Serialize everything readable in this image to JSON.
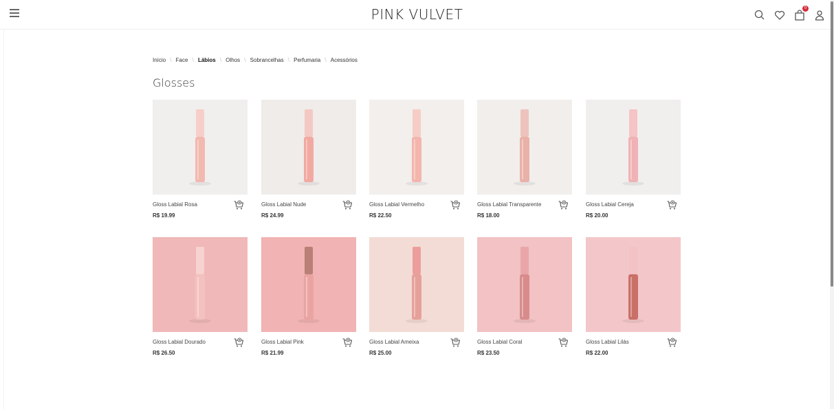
{
  "header": {
    "brand": "PINK VULVET",
    "cart_count": "0"
  },
  "breadcrumb": [
    {
      "label": "Início",
      "active": false
    },
    {
      "label": "Face",
      "active": false
    },
    {
      "label": "Lábios",
      "active": true
    },
    {
      "label": "Olhos",
      "active": false
    },
    {
      "label": "Sobrancelhas",
      "active": false
    },
    {
      "label": "Perfumaria",
      "active": false
    },
    {
      "label": "Acessórios",
      "active": false
    }
  ],
  "page_title": "Glosses",
  "products": [
    {
      "name": "Gloss Labial Rosa",
      "price": "R$ 19.99",
      "bg": "#f1efed",
      "tube": "#f2b9b0",
      "cap": "#f6cfc8"
    },
    {
      "name": "Gloss Labial Nude",
      "price": "R$ 24.99",
      "bg": "#efecea",
      "tube": "#f2a9a2",
      "cap": "#f5c9c3"
    },
    {
      "name": "Gloss Labial Vermelho",
      "price": "R$ 22.50",
      "bg": "#f2efed",
      "tube": "#f3b5ad",
      "cap": "#f6cdc6"
    },
    {
      "name": "Gloss Labial Transparente",
      "price": "R$ 18.00",
      "bg": "#f1eeec",
      "tube": "#e9b1a8",
      "cap": "#ecc4bd"
    },
    {
      "name": "Gloss Labial Cereja",
      "price": "R$ 20.00",
      "bg": "#f1efed",
      "tube": "#f0b2b4",
      "cap": "#f4c4c6"
    },
    {
      "name": "Gloss Labial Dourado",
      "price": "R$ 26.50",
      "bg": "#f0b8b8",
      "tube": "#f3c1bf",
      "cap": "#f6d2d0"
    },
    {
      "name": "Gloss Labial Pink",
      "price": "R$ 21.99",
      "bg": "#f1b3b3",
      "tube": "#e9a4a2",
      "cap": "#b88077"
    },
    {
      "name": "Gloss Labial Ameixa",
      "price": "R$ 25.00",
      "bg": "#f3dcd5",
      "tube": "#e6a09a",
      "cap": "#ec9e9c"
    },
    {
      "name": "Gloss Labial Coral",
      "price": "R$ 23.50",
      "bg": "#f2c2c4",
      "tube": "#d88b8b",
      "cap": "#e9a6a8"
    },
    {
      "name": "Gloss Labial Lilás",
      "price": "R$ 22.00",
      "bg": "#f3c7c9",
      "tube": "#c97069",
      "cap": "#f2c2c4"
    }
  ],
  "icons": {
    "menu": "menu-icon",
    "search": "search-icon",
    "wishlist": "heart-icon",
    "cart": "shopping-bag-icon",
    "account": "user-icon",
    "add_to_cart": "cart-add-icon"
  }
}
